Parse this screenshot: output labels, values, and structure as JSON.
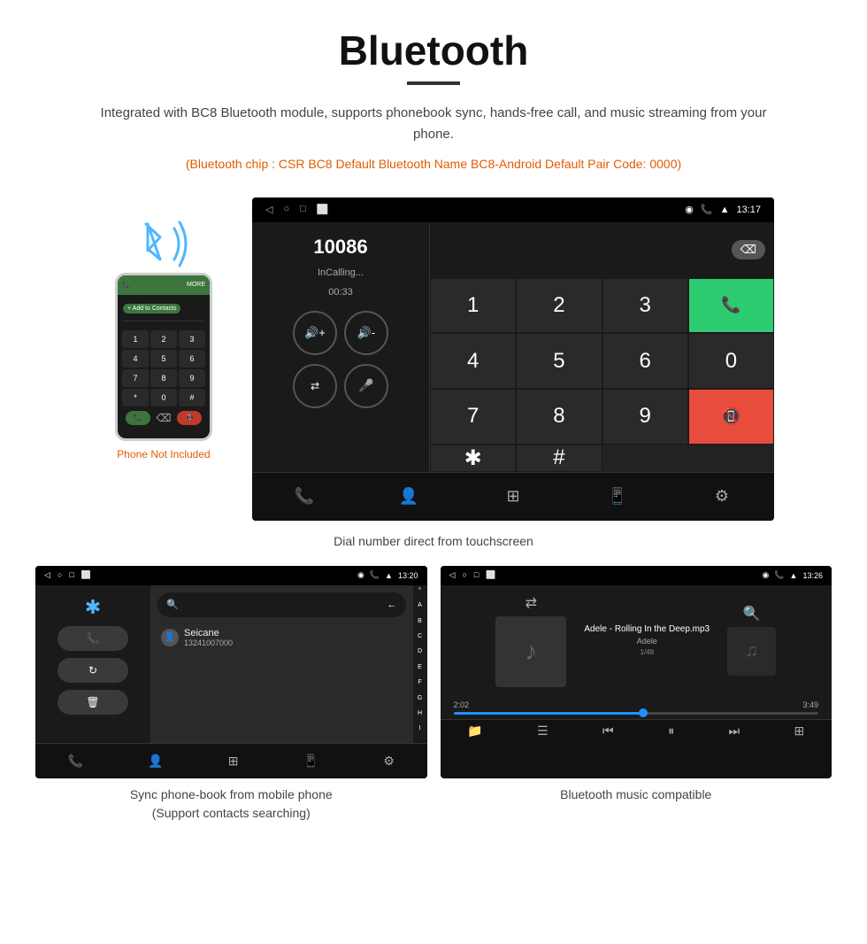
{
  "page": {
    "title": "Bluetooth",
    "divider": true,
    "description": "Integrated with BC8 Bluetooth module, supports phonebook sync, hands-free call, and music streaming from your phone.",
    "bt_info": "(Bluetooth chip : CSR BC8    Default Bluetooth Name BC8-Android    Default Pair Code: 0000)"
  },
  "dial_screen": {
    "status_bar": {
      "nav_back": "◁",
      "nav_home": "○",
      "nav_square": "□",
      "nav_extra": "⬜",
      "location": "📍",
      "signal": "📶",
      "time": "13:17"
    },
    "number": "10086",
    "status": "InCalling...",
    "call_time": "00:33",
    "keypad": {
      "keys": [
        "1",
        "2",
        "3",
        "4",
        "5",
        "6",
        "7",
        "8",
        "9",
        "✱",
        "0",
        "#"
      ]
    },
    "caption": "Dial number direct from touchscreen"
  },
  "phonebook_screen": {
    "status_bar": {
      "time": "13:20"
    },
    "contact": {
      "name": "Seicane",
      "number": "13241007000"
    },
    "alphabet": [
      "A",
      "B",
      "C",
      "D",
      "E",
      "F",
      "G",
      "H",
      "I"
    ],
    "caption_line1": "Sync phone-book from mobile phone",
    "caption_line2": "(Support contacts searching)"
  },
  "music_screen": {
    "status_bar": {
      "time": "13:26"
    },
    "track": "Adele - Rolling In the Deep.mp3",
    "artist": "Adele",
    "track_num": "1/48",
    "time_current": "2:02",
    "time_total": "3:49",
    "progress_percent": 52,
    "caption": "Bluetooth music compatible"
  },
  "phone_illustration": {
    "not_included": "Phone Not Included"
  }
}
